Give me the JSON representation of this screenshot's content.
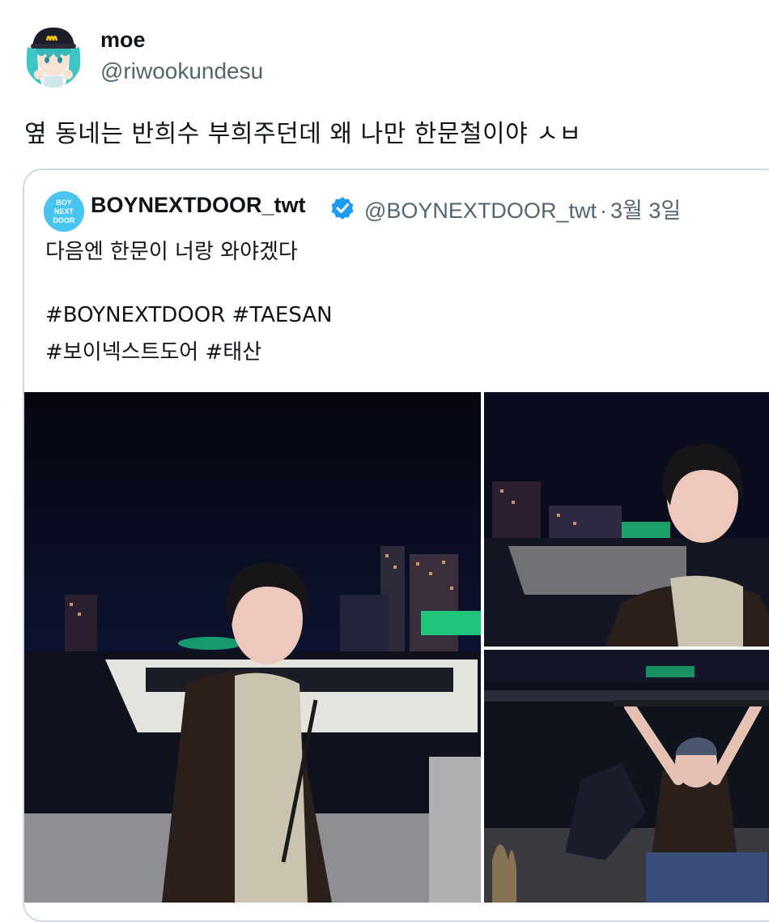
{
  "tweet": {
    "author_name": "moe",
    "author_handle": "@riwookundesu",
    "text": "옆 동네는 반희수 부희주던데 왜 나만 한문철이야 ㅅㅂ"
  },
  "quoted_tweet": {
    "author_name": "BOYNEXTDOOR_twt",
    "author_handle": "@BOYNEXTDOOR_twt",
    "separator": "·",
    "date": "3월 3일",
    "text_lines": [
      "다음엔 한문이 너랑 와야겠다",
      "",
      "#BOYNEXTDOOR #TAESAN",
      "#보이넥스트도어 #태산"
    ],
    "avatar_logo_text": [
      "BOY",
      "NEXT",
      "DOOR"
    ],
    "verified_icon": "verified-badge-icon"
  },
  "media": {
    "photos": [
      "photo-night-riverside-portrait",
      "photo-night-closeup",
      "photo-night-arms-raised"
    ]
  },
  "colors": {
    "text_primary": "#0f1419",
    "text_secondary": "#536471",
    "border": "#cfd9de",
    "verified_blue": "#1d9bf0",
    "night_sky": "#0a0c1e"
  }
}
